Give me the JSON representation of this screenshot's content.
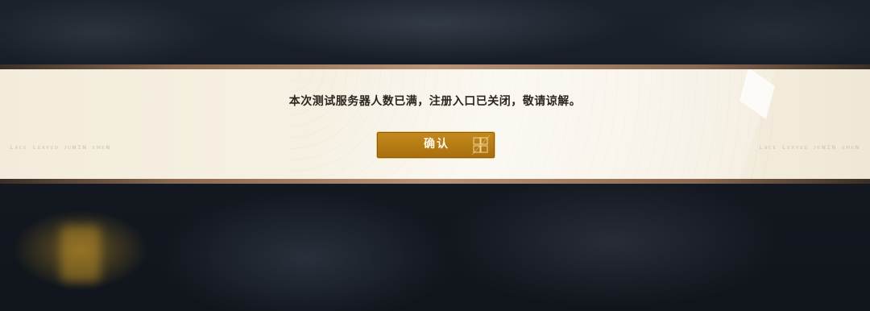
{
  "dialog": {
    "message": "本次测试服务器人数已满，注册入口已关闭，敬请谅解。",
    "confirm_label": "确认"
  },
  "decor": {
    "side_mark_left": "ʟᴀᴄᴇ ʟᴇᴀᴠᴇᴅ ᴊᴜɴɪɴ ᴇʜᴇɴ",
    "side_mark_right": "ʟᴀᴄᴇ ʟᴇᴀᴠᴇᴅ ᴊᴜɴɪɴ ᴇʜᴇɴ"
  },
  "colors": {
    "button_fill": "#b47a14",
    "button_border": "#e8c77a",
    "banner_paper": "#f6f0e2",
    "message_text": "#2b2620"
  }
}
